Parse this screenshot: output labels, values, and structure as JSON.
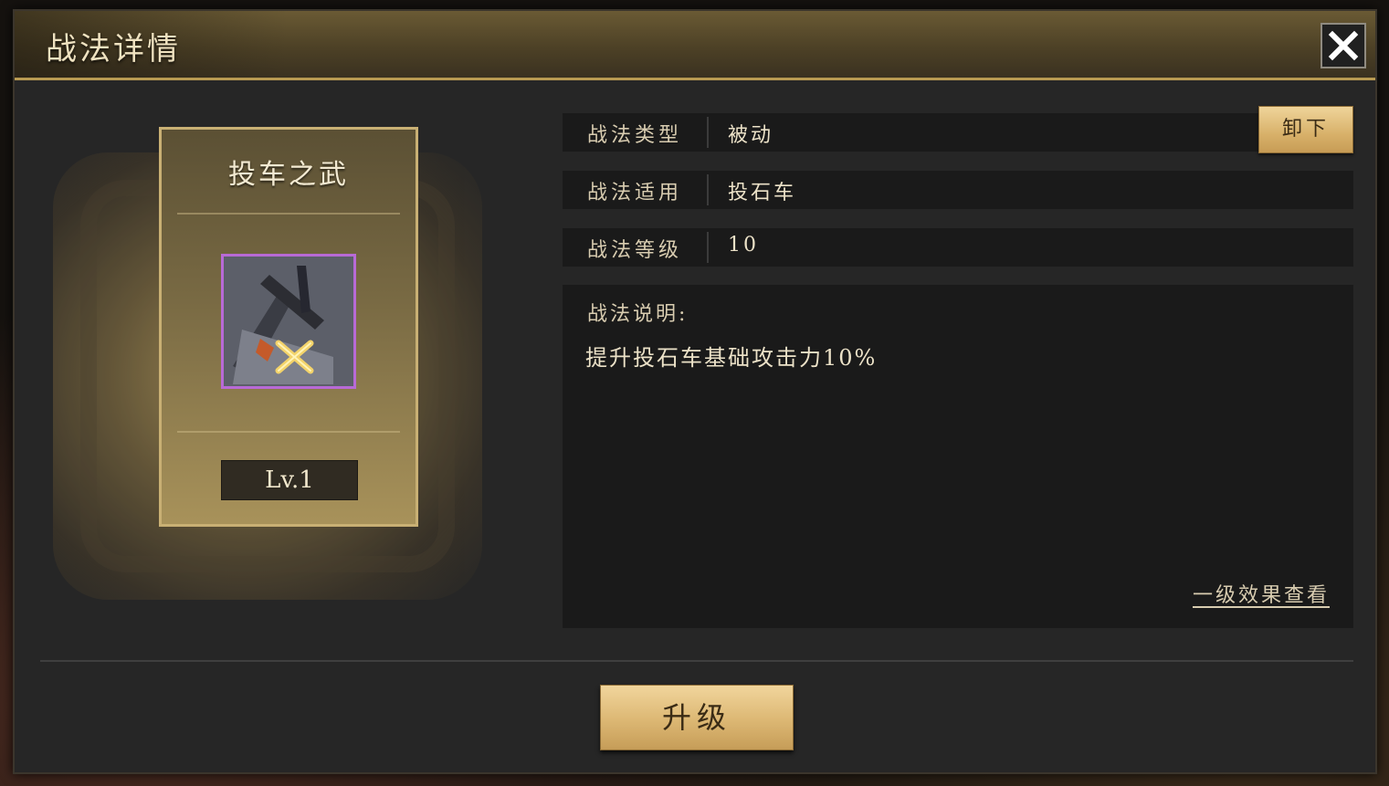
{
  "dialog": {
    "title": "战法详情"
  },
  "skill_card": {
    "name": "投车之武",
    "icon": "catapult-skill-icon",
    "level": "Lv.1"
  },
  "info": {
    "type_label": "战法类型",
    "type_value": "被动",
    "applicable_label": "战法适用",
    "applicable_value": "投石车",
    "level_label": "战法等级",
    "level_value": "10"
  },
  "description": {
    "heading": "战法说明:",
    "text": "提升投石车基础攻击力10%",
    "effect_link": "一级效果查看"
  },
  "buttons": {
    "unequip": "卸下",
    "upgrade": "升级"
  },
  "colors": {
    "accent_gold": "#d8b16a",
    "icon_frame": "#b86ad6"
  }
}
